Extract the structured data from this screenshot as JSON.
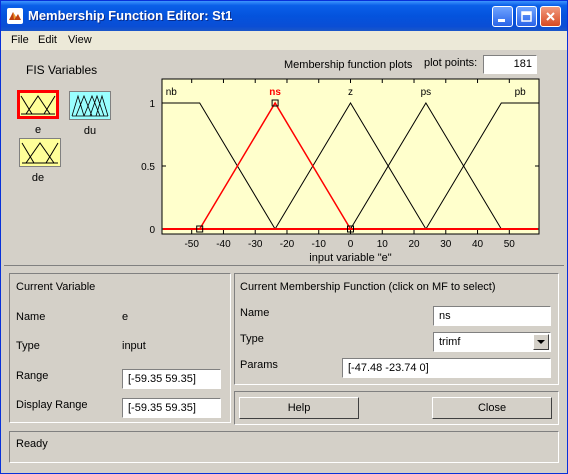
{
  "window": {
    "title": "Membership Function Editor: St1"
  },
  "menu": [
    {
      "label": "File"
    },
    {
      "label": "Edit"
    },
    {
      "label": "View"
    }
  ],
  "fis": {
    "label": "FIS Variables",
    "variables": [
      {
        "name": "e",
        "selected": true
      },
      {
        "name": "du",
        "selected": false
      },
      {
        "name": "de",
        "selected": false
      }
    ]
  },
  "plot_header": {
    "title": "Membership function plots",
    "plot_points_label": "plot points:",
    "plot_points_value": "181"
  },
  "chart_data": {
    "type": "line",
    "xlabel": "input variable \"e\"",
    "xlim": [
      -59.35,
      59.35
    ],
    "ylim": [
      0,
      1
    ],
    "xticks": [
      "-50",
      "-40",
      "-30",
      "-20",
      "-10",
      "0",
      "10",
      "20",
      "30",
      "40",
      "50"
    ],
    "xtick_values": [
      -50,
      -40,
      -30,
      -20,
      -10,
      0,
      10,
      20,
      30,
      40,
      50
    ],
    "yticks": [
      "0",
      "0.5",
      "1"
    ],
    "ytick_values": [
      0,
      0.5,
      1
    ],
    "background_color": "#ffffcc",
    "selected_color": "#ff0000",
    "series": [
      {
        "name": "nb",
        "x": [
          -59.35,
          -47.48,
          -23.74
        ],
        "y": [
          1,
          1,
          0
        ],
        "selected": false
      },
      {
        "name": "ns",
        "x": [
          -47.48,
          -23.74,
          0
        ],
        "y": [
          0,
          1,
          0
        ],
        "selected": true
      },
      {
        "name": "z",
        "x": [
          -23.74,
          0,
          23.74
        ],
        "y": [
          0,
          1,
          0
        ],
        "selected": false
      },
      {
        "name": "ps",
        "x": [
          0,
          23.74,
          47.48
        ],
        "y": [
          0,
          1,
          0
        ],
        "selected": false
      },
      {
        "name": "pb",
        "x": [
          23.74,
          47.48,
          59.35
        ],
        "y": [
          0,
          1,
          1
        ],
        "selected": false
      }
    ]
  },
  "current_variable": {
    "header": "Current Variable",
    "name_label": "Name",
    "name_value": "e",
    "type_label": "Type",
    "type_value": "input",
    "range_label": "Range",
    "range_value": "[-59.35 59.35]",
    "display_range_label": "Display Range",
    "display_range_value": "[-59.35 59.35]"
  },
  "current_mf": {
    "header": "Current Membership Function (click on MF to select)",
    "name_label": "Name",
    "name_value": "ns",
    "type_label": "Type",
    "type_value": "trimf",
    "params_label": "Params",
    "params_value": "[-47.48 -23.74 0]"
  },
  "buttons": {
    "help": "Help",
    "close": "Close"
  },
  "status": {
    "text": "Ready"
  },
  "colors": {
    "title_bar": "#0a5fe8",
    "selection": "#ff0000",
    "var_input": "#ffff99",
    "var_output": "#99ffff"
  }
}
